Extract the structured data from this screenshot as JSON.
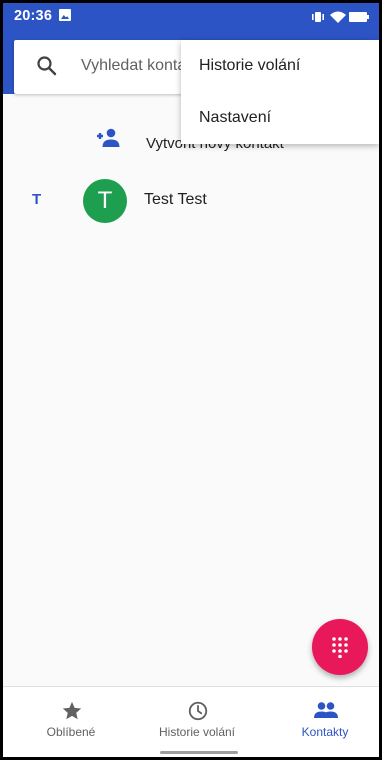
{
  "status_bar": {
    "time": "20:36",
    "notification_icon": "image-icon",
    "indicator_icons": [
      "vibrate-icon",
      "wifi-icon",
      "battery-icon"
    ]
  },
  "search": {
    "placeholder": "Vyhledat kontakty",
    "icon": "search-icon"
  },
  "actions": {
    "create_contact": "Vytvořit nový kontakt"
  },
  "contacts": {
    "sections": [
      {
        "letter": "T",
        "items": [
          {
            "name": "Test Test",
            "initial": "T",
            "avatar_color": "#1e9e4f"
          }
        ]
      }
    ]
  },
  "overflow_menu": {
    "items": [
      "Historie volání",
      "Nastavení"
    ]
  },
  "fab": {
    "icon": "dialpad-icon",
    "color": "#e8185a"
  },
  "bottom_nav": {
    "items": [
      {
        "label": "Oblíbené",
        "icon": "star-icon",
        "active": false
      },
      {
        "label": "Historie volání",
        "icon": "clock-icon",
        "active": false
      },
      {
        "label": "Kontakty",
        "icon": "people-icon",
        "active": true
      }
    ]
  },
  "colors": {
    "accent": "#2c54c4",
    "fab": "#e8185a",
    "avatar": "#1e9e4f"
  }
}
